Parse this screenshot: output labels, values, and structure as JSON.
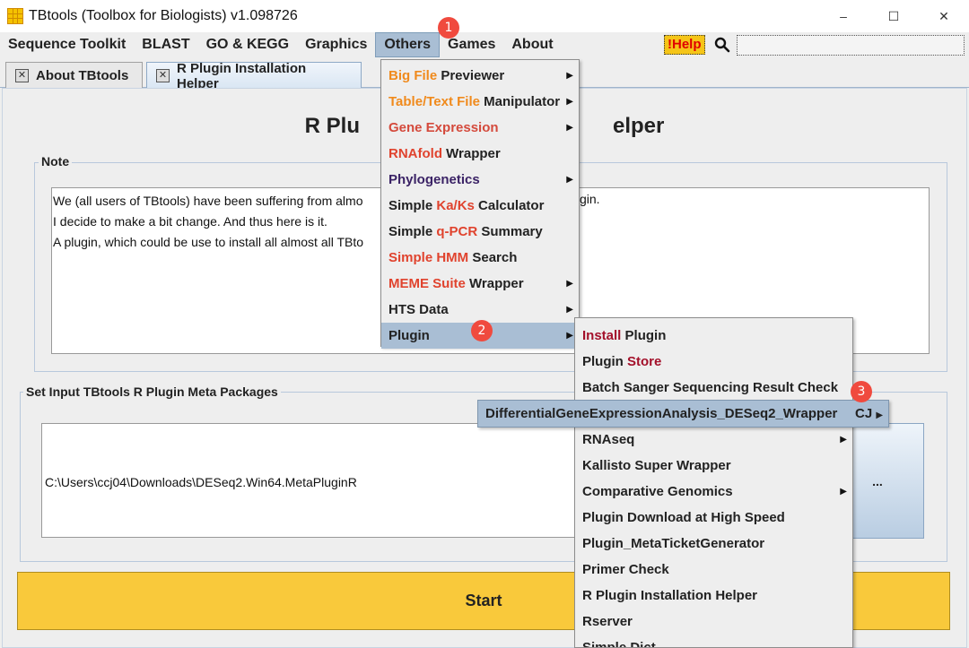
{
  "window": {
    "title": "TBtools (Toolbox for Biologists) v1.098726",
    "minimize": "–",
    "maximize": "☐",
    "close": "✕"
  },
  "menubar": {
    "items": [
      "Sequence Toolkit",
      "BLAST",
      "GO & KEGG",
      "Graphics",
      "Others",
      "Games",
      "About"
    ],
    "help_label": "!Help",
    "search_placeholder": ""
  },
  "tabs": [
    {
      "label": "About TBtools",
      "close": "✕"
    },
    {
      "label": "R Plugin Installation Helper",
      "close": "✕"
    }
  ],
  "main": {
    "title": "R Plu",
    "title_tail": "elper",
    "note_label": "Note",
    "note_lines": [
      "We (all users of TBtools) have been suffering from almo",
      "I decide to make a bit change. And thus here is it.",
      "A plugin, which could be use to install all almost all TBto"
    ],
    "note_line1_tail": "gin.",
    "meta_label": "Set Input TBtools R Plugin Meta Packages",
    "path_value": "C:\\Users\\ccj04\\Downloads\\DESeq2.Win64.MetaPluginR",
    "browse_label": "...",
    "start_label": "Start"
  },
  "others_menu": [
    {
      "parts": [
        {
          "t": "Big File",
          "c": "orange"
        },
        {
          "t": " Previewer",
          "c": ""
        }
      ],
      "submenu": true
    },
    {
      "parts": [
        {
          "t": "Table/Text File",
          "c": "orange"
        },
        {
          "t": " Manipulator",
          "c": ""
        }
      ],
      "submenu": true
    },
    {
      "parts": [
        {
          "t": "Gene Expression",
          "c": "red"
        }
      ],
      "submenu": true
    },
    {
      "parts": [
        {
          "t": "RNAfold",
          "c": "red2"
        },
        {
          "t": " Wrapper",
          "c": ""
        }
      ],
      "submenu": false
    },
    {
      "parts": [
        {
          "t": "Phylogenetics",
          "c": "purple"
        }
      ],
      "submenu": true
    },
    {
      "parts": [
        {
          "t": "Simple ",
          "c": ""
        },
        {
          "t": "Ka/Ks",
          "c": "red2"
        },
        {
          "t": " Calculator",
          "c": ""
        }
      ],
      "submenu": false
    },
    {
      "parts": [
        {
          "t": "Simple ",
          "c": ""
        },
        {
          "t": "q-PCR",
          "c": "red2"
        },
        {
          "t": " Summary",
          "c": ""
        }
      ],
      "submenu": false
    },
    {
      "parts": [
        {
          "t": "Simple HMM",
          "c": "red2"
        },
        {
          "t": " Search",
          "c": ""
        }
      ],
      "submenu": false
    },
    {
      "parts": [
        {
          "t": "MEME Suite",
          "c": "red2"
        },
        {
          "t": " Wrapper",
          "c": ""
        }
      ],
      "submenu": true
    },
    {
      "parts": [
        {
          "t": "HTS Data",
          "c": ""
        }
      ],
      "submenu": true
    },
    {
      "parts": [
        {
          "t": "Plugin",
          "c": ""
        }
      ],
      "submenu": true,
      "highlighted": true
    }
  ],
  "plugin_menu": [
    {
      "parts": [
        {
          "t": "Install",
          "c": "crimson"
        },
        {
          "t": " Plugin",
          "c": ""
        }
      ],
      "submenu": false
    },
    {
      "parts": [
        {
          "t": "Plugin ",
          "c": ""
        },
        {
          "t": "Store",
          "c": "crimson"
        }
      ],
      "submenu": false
    },
    {
      "parts": [
        {
          "t": "Batch Sanger Sequencing Result Check",
          "c": ""
        }
      ],
      "submenu": false
    },
    {
      "parts": [
        {
          "t": "",
          "c": ""
        }
      ],
      "submenu": false
    },
    {
      "parts": [
        {
          "t": "RNAseq",
          "c": ""
        }
      ],
      "submenu": true
    },
    {
      "parts": [
        {
          "t": "Kallisto Super Wrapper",
          "c": ""
        }
      ],
      "submenu": false
    },
    {
      "parts": [
        {
          "t": "Comparative Genomics",
          "c": ""
        }
      ],
      "submenu": true
    },
    {
      "parts": [
        {
          "t": "Plugin Download at High Speed",
          "c": ""
        }
      ],
      "submenu": false
    },
    {
      "parts": [
        {
          "t": "Plugin_MetaTicketGenerator",
          "c": ""
        }
      ],
      "submenu": false
    },
    {
      "parts": [
        {
          "t": "Primer Check",
          "c": ""
        }
      ],
      "submenu": false
    },
    {
      "parts": [
        {
          "t": "R Plugin Installation Helper",
          "c": ""
        }
      ],
      "submenu": false
    },
    {
      "parts": [
        {
          "t": "Rserver",
          "c": ""
        }
      ],
      "submenu": false
    },
    {
      "parts": [
        {
          "t": "Simple Dict",
          "c": ""
        }
      ],
      "submenu": false
    }
  ],
  "deseq_menu": {
    "label": "DifferentialGeneExpressionAnalysis_DESeq2_Wrapper",
    "tail": "CJ"
  },
  "badges": [
    "1",
    "2",
    "3"
  ],
  "colors": {
    "orange": "#f08a1c",
    "red": "#d44a3c",
    "red2": "#e0432e",
    "purple": "#3b2366",
    "crimson": "#a3102a",
    "highlight": "#a9bed4",
    "start_button": "#f9c93b",
    "badge": "#f04a3e"
  }
}
